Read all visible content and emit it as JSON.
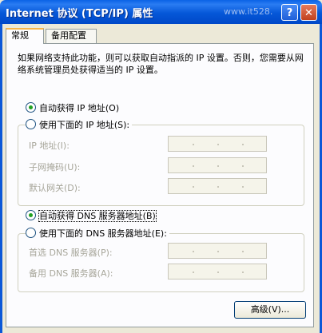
{
  "window": {
    "title": "Internet 协议 (TCP/IP) 属性",
    "watermark": "www.it528.",
    "help_label": "?",
    "close_label": "✕"
  },
  "tabs": [
    {
      "label": "常规"
    },
    {
      "label": "备用配置"
    }
  ],
  "description": "如果网络支持此功能，则可以获取自动指派的 IP 设置。否则，您需要从网络系统管理员处获得适当的 IP 设置。",
  "ip": {
    "auto_label": "自动获得 IP 地址(O)",
    "manual_label": "使用下面的 IP 地址(S):",
    "selected": "auto",
    "fields": [
      {
        "label": "IP 地址(I):",
        "value": ""
      },
      {
        "label": "子网掩码(U):",
        "value": ""
      },
      {
        "label": "默认网关(D):",
        "value": ""
      }
    ]
  },
  "dns": {
    "auto_label": "自动获得 DNS 服务器地址(B)",
    "manual_label": "使用下面的 DNS 服务器地址(E):",
    "selected": "auto",
    "fields": [
      {
        "label": "首选 DNS 服务器(P):",
        "value": ""
      },
      {
        "label": "备用 DNS 服务器(A):",
        "value": ""
      }
    ]
  },
  "buttons": {
    "advanced_label": "高级(V)..."
  }
}
